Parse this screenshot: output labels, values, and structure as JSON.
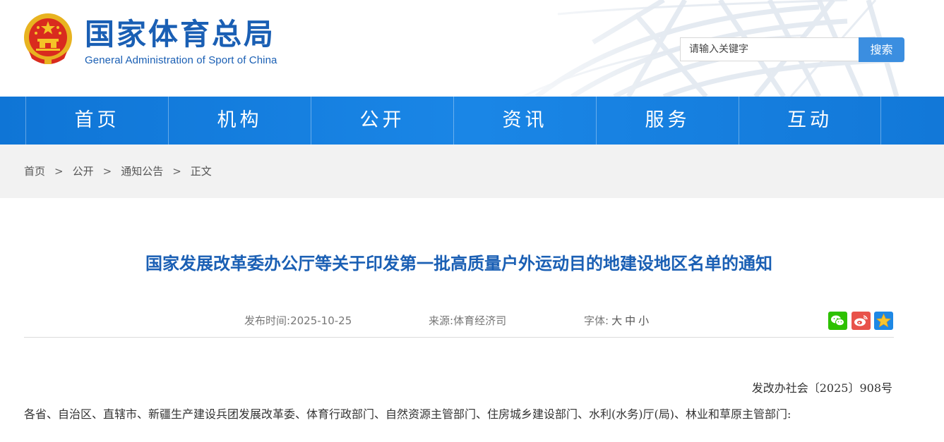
{
  "site": {
    "name_cn": "国家体育总局",
    "name_en": "General Administration of Sport of China",
    "search_placeholder": "请输入关键字",
    "search_button": "搜索"
  },
  "nav": {
    "items": [
      "首页",
      "机构",
      "公开",
      "资讯",
      "服务",
      "互动"
    ]
  },
  "breadcrumb": {
    "items": [
      "首页",
      "公开",
      "通知公告",
      "正文"
    ],
    "separator": ">"
  },
  "article": {
    "title": "国家发展改革委办公厅等关于印发第一批高质量户外运动目的地建设地区名单的通知",
    "publish_label": "发布时间:",
    "publish_date": "2025-10-25",
    "source_label": "来源:",
    "source": "体育经济司",
    "font_label": "字体:",
    "font_sizes": [
      "大",
      "中",
      "小"
    ],
    "doc_number": "发改办社会〔2025〕908号",
    "body": "各省、自治区、直辖市、新疆生产建设兵团发展改革委、体育行政部门、自然资源主管部门、住房城乡建设部门、水利(水务)厅(局)、林业和草原主管部门:"
  },
  "share": {
    "icons": [
      "wechat-icon",
      "weibo-icon",
      "favorite-star-icon"
    ],
    "colors": {
      "wechat": "#2dc100",
      "weibo": "#e8524a",
      "favorite": "#1e88e5"
    }
  },
  "colors": {
    "brand": "#1a5fb4",
    "nav_bg": "#1580e0",
    "search_button": "#3b8ee0",
    "breadcrumb_bg": "#f2f2f2"
  }
}
